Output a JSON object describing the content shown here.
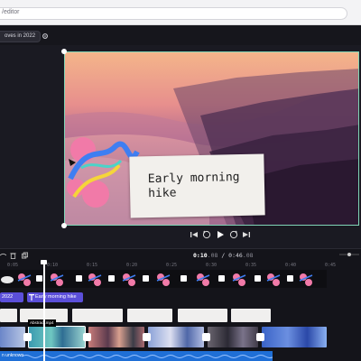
{
  "browser": {
    "url_text": "/editor"
  },
  "project": {
    "title_chip": "oves in 2022"
  },
  "preview": {
    "caption": "Early morning hike"
  },
  "player": {
    "current_time": "0:10",
    "current_frac": ".08",
    "separator": "/",
    "total_time": "0:46",
    "total_frac": ".08"
  },
  "ruler": {
    "ticks": [
      "0:05",
      "0:10",
      "0:15",
      "0:20",
      "0:25",
      "0:30",
      "0:35",
      "0:40",
      "0:45"
    ]
  },
  "timeline": {
    "text_clip_a": "2022",
    "text_clip_b": "Early morning hike",
    "video_tooltip": "Abstract.mp4",
    "audio_label": "n unknown"
  },
  "colors": {
    "accent": "#5b4fd9",
    "selection": "#7fd6b7",
    "audio": "#1f6fd6",
    "background": "#1a1a22"
  },
  "icons": [
    "settings-icon",
    "skip-back-icon",
    "rewind-5-icon",
    "play-icon",
    "forward-5-icon",
    "skip-forward-icon",
    "undo-icon",
    "redo-icon",
    "trash-icon",
    "duplicate-icon",
    "zoom-icon",
    "transition-icon"
  ]
}
